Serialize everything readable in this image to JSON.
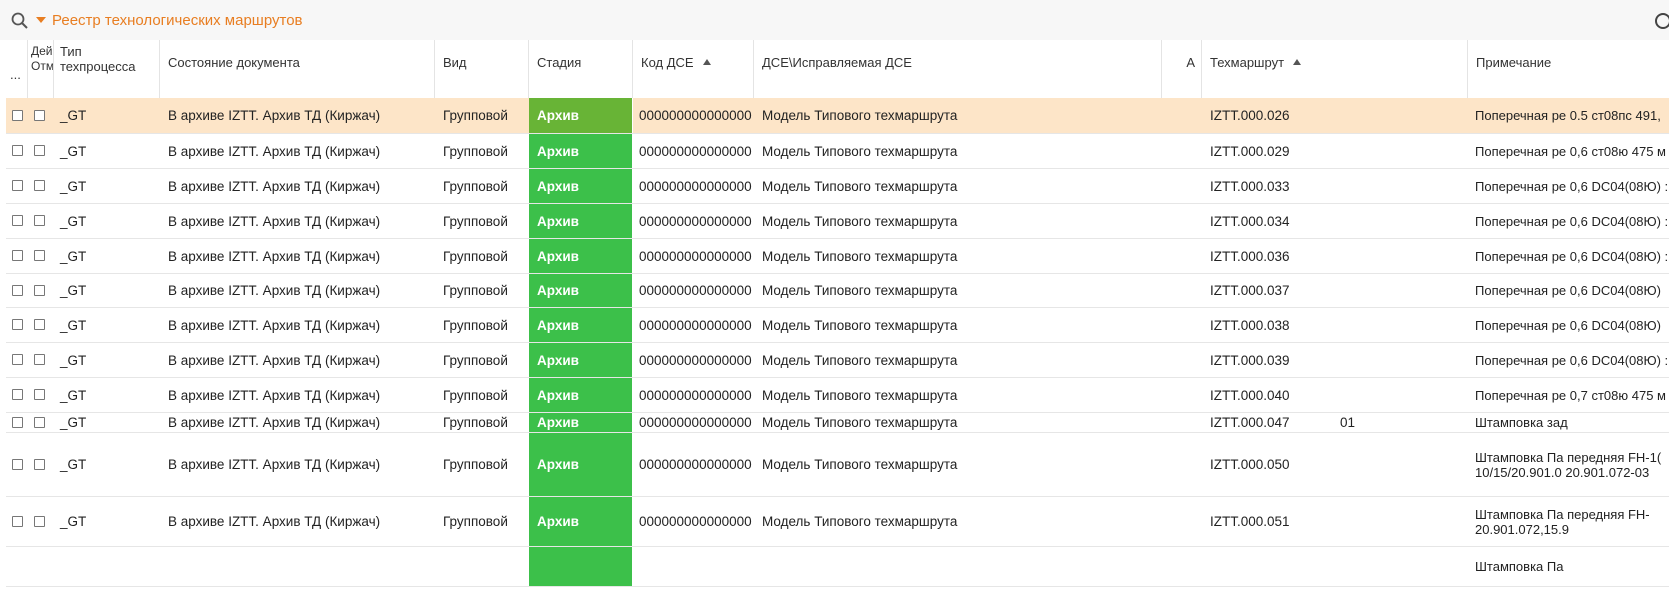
{
  "app": {
    "title": "Реестр технологических маршрутов",
    "search_icon": "search-icon",
    "expand_icon": "caret-down-icon"
  },
  "colors": {
    "accent": "#e87e22",
    "stage_green": "#3cc04a",
    "selected_row": "#fde5c8"
  },
  "columns": [
    {
      "key": "sel",
      "label": "..."
    },
    {
      "key": "act",
      "label": "Дей Отм"
    },
    {
      "key": "type",
      "label": "Тип техпроцесса"
    },
    {
      "key": "state",
      "label": "Состояние документа"
    },
    {
      "key": "kind",
      "label": "Вид"
    },
    {
      "key": "stage",
      "label": "Стадия"
    },
    {
      "key": "code",
      "label": "Код ДСЕ",
      "sorted": "asc"
    },
    {
      "key": "dse",
      "label": "ДСЕ\\Исправляемая ДСЕ"
    },
    {
      "key": "a",
      "label": "А"
    },
    {
      "key": "route",
      "label": "Техмаршрут",
      "sorted": "asc"
    },
    {
      "key": "note",
      "label": "Примечание"
    }
  ],
  "rows": [
    {
      "type": "_GT",
      "state": "В архиве IZTT. Архив ТД (Киржач)",
      "kind": "Групповой",
      "stage": "Архив",
      "code": "000000000000000",
      "dse": "Модель Типового техмаршрута",
      "route": "IZTT.000.026",
      "extra": "",
      "note": "Поперечная ре 0.5 ст08пс 491,",
      "selected": true
    },
    {
      "type": "_GT",
      "state": "В архиве IZTT. Архив ТД (Киржач)",
      "kind": "Групповой",
      "stage": "Архив",
      "code": "000000000000000",
      "dse": "Модель Типового техмаршрута",
      "route": "IZTT.000.029",
      "extra": "",
      "note": "Поперечная ре 0,6 ст08ю 475 м"
    },
    {
      "type": "_GT",
      "state": "В архиве IZTT. Архив ТД (Киржач)",
      "kind": "Групповой",
      "stage": "Архив",
      "code": "000000000000000",
      "dse": "Модель Типового техмаршрута",
      "route": "IZTT.000.033",
      "extra": "",
      "note": "Поперечная ре 0,6 DC04(08Ю) :"
    },
    {
      "type": "_GT",
      "state": "В архиве IZTT. Архив ТД (Киржач)",
      "kind": "Групповой",
      "stage": "Архив",
      "code": "000000000000000",
      "dse": "Модель Типового техмаршрута",
      "route": "IZTT.000.034",
      "extra": "",
      "note": "Поперечная ре 0,6 DC04(08Ю) :"
    },
    {
      "type": "_GT",
      "state": "В архиве IZTT. Архив ТД (Киржач)",
      "kind": "Групповой",
      "stage": "Архив",
      "code": "000000000000000",
      "dse": "Модель Типового техмаршрута",
      "route": "IZTT.000.036",
      "extra": "",
      "note": "Поперечная ре 0,6 DC04(08Ю) :"
    },
    {
      "type": "_GT",
      "state": "В архиве IZTT. Архив ТД (Киржач)",
      "kind": "Групповой",
      "stage": "Архив",
      "code": "000000000000000",
      "dse": "Модель Типового техмаршрута",
      "route": "IZTT.000.037",
      "extra": "",
      "note": "Поперечная ре 0,6 DC04(08Ю)"
    },
    {
      "type": "_GT",
      "state": "В архиве IZTT. Архив ТД (Киржач)",
      "kind": "Групповой",
      "stage": "Архив",
      "code": "000000000000000",
      "dse": "Модель Типового техмаршрута",
      "route": "IZTT.000.038",
      "extra": "",
      "note": "Поперечная ре 0,6 DC04(08Ю)"
    },
    {
      "type": "_GT",
      "state": "В архиве IZTT. Архив ТД (Киржач)",
      "kind": "Групповой",
      "stage": "Архив",
      "code": "000000000000000",
      "dse": "Модель Типового техмаршрута",
      "route": "IZTT.000.039",
      "extra": "",
      "note": "Поперечная ре 0,6 DC04(08Ю) :"
    },
    {
      "type": "_GT",
      "state": "В архиве IZTT. Архив ТД (Киржач)",
      "kind": "Групповой",
      "stage": "Архив",
      "code": "000000000000000",
      "dse": "Модель Типового техмаршрута",
      "route": "IZTT.000.040",
      "extra": "",
      "note": "Поперечная ре 0,7 ст08ю 475 м"
    },
    {
      "type": "_GT",
      "state": "В архиве IZTT. Архив ТД (Киржач)",
      "kind": "Групповой",
      "stage": "Архив",
      "code": "000000000000000",
      "dse": "Модель Типового техмаршрута",
      "route": "IZTT.000.047",
      "extra": "01",
      "note": "Штамповка зад"
    },
    {
      "type": "_GT",
      "state": "В архиве IZTT. Архив ТД (Киржач)",
      "kind": "Групповой",
      "stage": "Архив",
      "code": "000000000000000",
      "dse": "Модель Типового техмаршрута",
      "route": "IZTT.000.050",
      "extra": "",
      "note": "Штамповка Па передняя FH-1( 10/15/20.901.0 20.901.072-03"
    },
    {
      "type": "_GT",
      "state": "В архиве IZTT. Архив ТД (Киржач)",
      "kind": "Групповой",
      "stage": "Архив",
      "code": "000000000000000",
      "dse": "Модель Типового техмаршрута",
      "route": "IZTT.000.051",
      "extra": "",
      "note": "Штамповка Па передняя FH- 20.901.072,15.9"
    },
    {
      "type": "",
      "state": "",
      "kind": "",
      "stage": "",
      "code": "",
      "dse": "",
      "route": "",
      "extra": "",
      "note": "Штамповка Па"
    }
  ]
}
